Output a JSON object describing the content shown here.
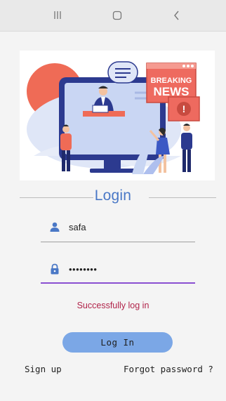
{
  "system_nav": {
    "recents_icon": "recents-icon",
    "home_icon": "home-icon",
    "back_icon": "back-icon"
  },
  "hero": {
    "badge_line1": "BREAKING",
    "badge_line2": "NEWS",
    "alert_mark": "!"
  },
  "login": {
    "title": "Login",
    "username_value": "safa",
    "password_value": "••••••••",
    "status_message": "Successfully log in",
    "button_label": "Log In",
    "signup_link": "Sign up",
    "forgot_link": "Forgot password ?"
  },
  "colors": {
    "accent": "#4a78c6",
    "button": "#7ba7e6",
    "focus_underline": "#8a4fd1",
    "status": "#b1244a",
    "news_badge": "#ee6a5f"
  }
}
